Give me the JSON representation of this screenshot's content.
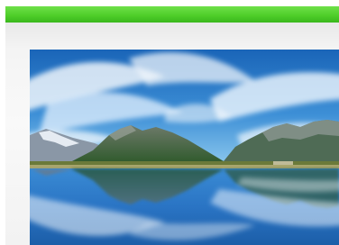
{
  "colors": {
    "top_bar": "#4fcf2a",
    "panel": "#f4f4f4",
    "sky_top": "#1f6fbf",
    "sky_bottom": "#7fc1ea",
    "water": "#2b77c8"
  },
  "image": {
    "subject": "landscape-photo",
    "icon": "mountain-lake-reflection"
  }
}
